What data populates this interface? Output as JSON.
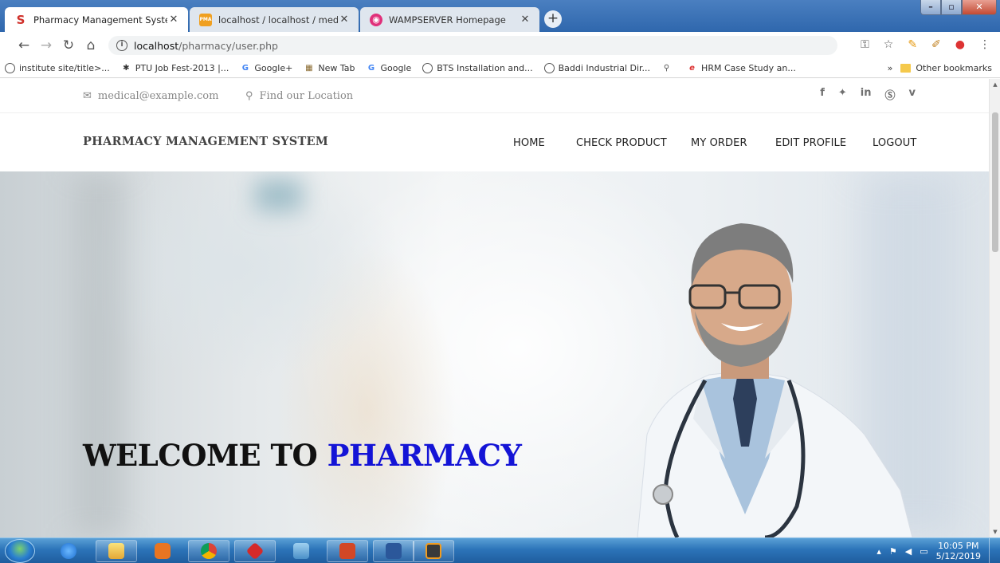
{
  "browser": {
    "tabs": [
      {
        "title": "Pharmacy Management System",
        "favicon": "S",
        "active": true
      },
      {
        "title": "localhost / localhost / medical / t",
        "favicon": "PMA",
        "active": false
      },
      {
        "title": "WAMPSERVER Homepage",
        "favicon": "W",
        "active": false
      }
    ],
    "url_host": "localhost",
    "url_path": "/pharmacy/user.php",
    "bookmarks": [
      "institute site/title>...",
      "PTU Job Fest-2013 |...",
      "Google+",
      "New Tab",
      "Google",
      "BTS Installation and...",
      "Baddi Industrial Dir...",
      "",
      "HRM Case Study an..."
    ],
    "other_bookmarks": "Other bookmarks",
    "overflow": "»"
  },
  "topbar": {
    "email": "medical@example.com",
    "location": "Find our Location",
    "socials": [
      "f",
      "t",
      "in",
      "s",
      "v"
    ]
  },
  "nav": {
    "brand": "PHARMACY MANAGEMENT SYSTEM",
    "items": [
      "HOME",
      "CHECK PRODUCT",
      "MY ORDER",
      "EDIT PROFILE",
      "LOGOUT"
    ]
  },
  "hero": {
    "welcome": "WELCOME TO",
    "highlight": "PHARMACY"
  },
  "taskbar": {
    "time": "10:05 PM",
    "date": "5/12/2019"
  },
  "colors": {
    "highlight": "#1414d6",
    "tabstrip": "#2f67ad"
  }
}
